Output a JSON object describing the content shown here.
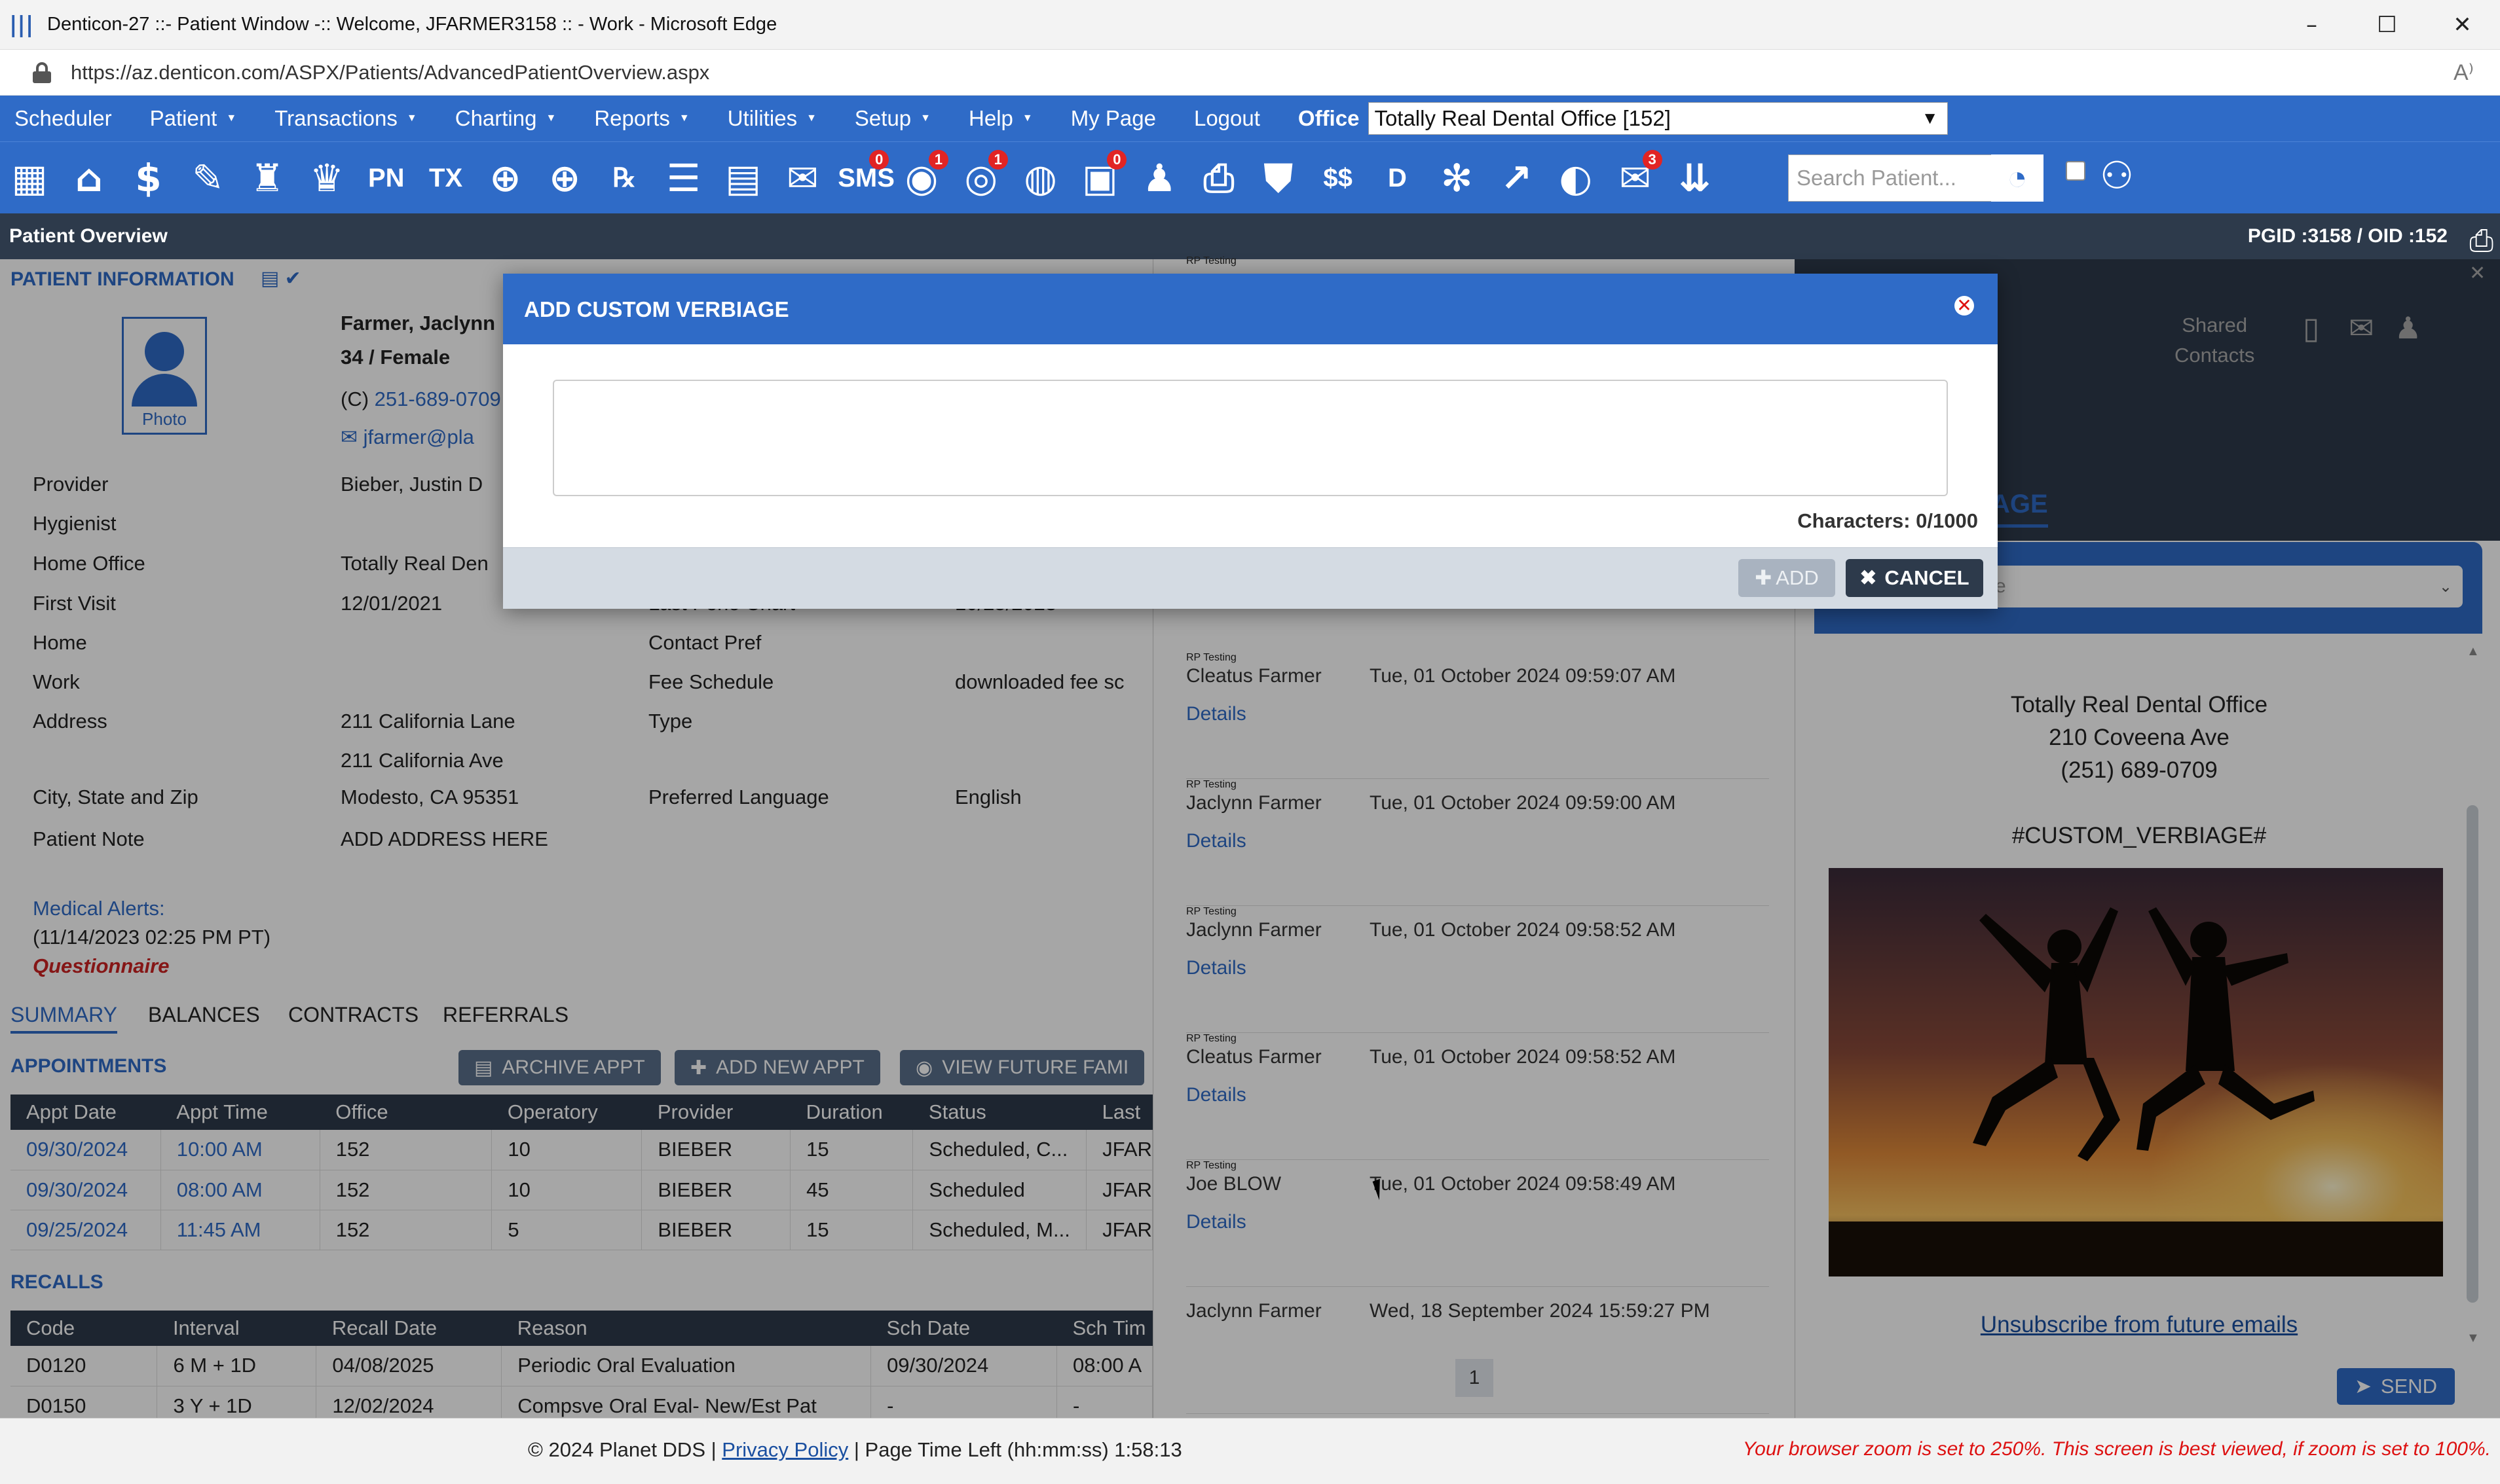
{
  "window": {
    "title": "Denticon-27 ::- Patient Window -:: Welcome, JFARMER3158 :: - Work - Microsoft Edge",
    "url": "https://az.denticon.com/ASPX/Patients/AdvancedPatientOverview.aspx"
  },
  "nav": {
    "items": [
      {
        "label": "Scheduler",
        "caret": false
      },
      {
        "label": "Patient",
        "caret": true
      },
      {
        "label": "Transactions",
        "caret": true
      },
      {
        "label": "Charting",
        "caret": true
      },
      {
        "label": "Reports",
        "caret": true
      },
      {
        "label": "Utilities",
        "caret": true
      },
      {
        "label": "Setup",
        "caret": true
      },
      {
        "label": "Help",
        "caret": true
      },
      {
        "label": "My Page",
        "caret": false
      },
      {
        "label": "Logout",
        "caret": false
      }
    ],
    "office_label": "Office",
    "office_value": "Totally Real Dental Office [152]"
  },
  "toolbar": {
    "icons": [
      {
        "name": "calendar-icon",
        "glyph": "▦"
      },
      {
        "name": "home-icon",
        "glyph": "⌂"
      },
      {
        "name": "dollar-icon",
        "glyph": "$"
      },
      {
        "name": "edit-icon",
        "glyph": "✎"
      },
      {
        "name": "tooth-chart-icon",
        "glyph": "♜"
      },
      {
        "name": "tooth-icon",
        "glyph": "♛"
      },
      {
        "name": "pn-icon",
        "text": "PN"
      },
      {
        "name": "tx-icon",
        "text": "TX"
      },
      {
        "name": "add-user-icon",
        "glyph": "⊕"
      },
      {
        "name": "add-user-alt-icon",
        "glyph": "⊕"
      },
      {
        "name": "prescription-icon",
        "text": "℞"
      },
      {
        "name": "notes-icon",
        "glyph": "☰"
      },
      {
        "name": "document-icon",
        "glyph": "▤"
      },
      {
        "name": "mail-icon",
        "glyph": "✉"
      },
      {
        "name": "sms-icon",
        "text": "SMS",
        "badge": "0"
      },
      {
        "name": "web-users-icon",
        "glyph": "◉",
        "badge": "1"
      },
      {
        "name": "support-icon",
        "glyph": "◎",
        "badge": "1"
      },
      {
        "name": "globe-icon",
        "glyph": "◍"
      },
      {
        "name": "clipboard-icon",
        "glyph": "▣",
        "badge": "0"
      },
      {
        "name": "family-icon",
        "glyph": "♟"
      },
      {
        "name": "printer-icon",
        "glyph": "⎙"
      },
      {
        "name": "insurance-icon",
        "glyph": "⛊"
      },
      {
        "name": "claims-icon",
        "text": "$$"
      },
      {
        "name": "ledger-icon",
        "text": "D"
      },
      {
        "name": "network-icon",
        "glyph": "✻"
      },
      {
        "name": "analytics-icon",
        "glyph": "↗"
      },
      {
        "name": "profile-icon",
        "glyph": "◐"
      },
      {
        "name": "messages-icon",
        "glyph": "✉",
        "badge": "3"
      },
      {
        "name": "collapse-icon",
        "glyph": "⇊"
      }
    ],
    "search_placeholder": "Search Patient..."
  },
  "pagebar": {
    "title": "Patient Overview",
    "pgid": "PGID :3158  /  OID :152"
  },
  "patient": {
    "section": "PATIENT INFORMATION",
    "photo_label": "Photo",
    "name": "Farmer, Jaclynn",
    "age_sex": "34 / Female",
    "phone_prefix": "(C)",
    "phone": "251-689-0709",
    "email": "jfarmer@pla",
    "fields": [
      {
        "label": "Provider",
        "value": "Bieber, Justin D"
      },
      {
        "label": "Hygienist",
        "value": ""
      },
      {
        "label": "Home Office",
        "value": "Totally Real Den"
      },
      {
        "label": "First Visit",
        "value": "12/01/2021"
      },
      {
        "label": "Home",
        "value": ""
      },
      {
        "label": "Work",
        "value": ""
      },
      {
        "label": "Address",
        "value": "211 California Lane"
      },
      {
        "label": "",
        "value": "211 California Ave"
      },
      {
        "label": "City, State and Zip",
        "value": "Modesto, CA 95351"
      },
      {
        "label": "Patient Note",
        "value": "ADD ADDRESS HERE"
      }
    ],
    "mid_fields": [
      {
        "label": "Last Perio Chart",
        "value": "10/25/2023"
      },
      {
        "label": "Contact Pref",
        "value": ""
      },
      {
        "label": "Fee Schedule",
        "value": "downloaded fee sc"
      },
      {
        "label": "Type",
        "value": ""
      },
      {
        "label": "Preferred Language",
        "value": "English"
      }
    ],
    "medical_alerts": "Medical Alerts:",
    "alerts_date": "(11/14/2023 02:25 PM PT)",
    "questionnaire": "Questionnaire"
  },
  "tabs": [
    "SUMMARY",
    "BALANCES",
    "CONTRACTS",
    "REFERRALS"
  ],
  "appointments": {
    "title": "APPOINTMENTS",
    "buttons": [
      "ARCHIVE APPT",
      "ADD NEW APPT",
      "VIEW FUTURE FAMI"
    ],
    "headers": [
      "Appt Date",
      "Appt Time",
      "Office",
      "Operatory",
      "Provider",
      "Duration",
      "Status",
      "Last"
    ],
    "rows": [
      [
        "09/30/2024",
        "10:00 AM",
        "152",
        "10",
        "BIEBER",
        "15",
        "Scheduled, C...",
        "JFAR"
      ],
      [
        "09/30/2024",
        "08:00 AM",
        "152",
        "10",
        "BIEBER",
        "45",
        "Scheduled",
        "JFAR"
      ],
      [
        "09/25/2024",
        "11:45 AM",
        "152",
        "5",
        "BIEBER",
        "15",
        "Scheduled, M...",
        "JFAR"
      ]
    ]
  },
  "recalls": {
    "title": "RECALLS",
    "headers": [
      "Code",
      "Interval",
      "Recall Date",
      "Reason",
      "Sch Date",
      "Sch Tim"
    ],
    "rows": [
      [
        "D0120",
        "6 M + 1D",
        "04/08/2025",
        "Periodic Oral Evaluation",
        "09/30/2024",
        "08:00 A"
      ],
      [
        "D0150",
        "3 Y + 1D",
        "12/02/2024",
        "Compsve Oral Eval- New/Est Pat",
        "-",
        "-"
      ]
    ]
  },
  "messages": [
    {
      "from": "",
      "when": "",
      "details": "Details",
      "subject": "RP Testing"
    },
    {
      "from": "Cleatus Farmer",
      "when": "Tue, 01 October 2024 09:59:07 AM",
      "details": "Details",
      "subject": "RP Testing"
    },
    {
      "from": "Jaclynn Farmer",
      "when": "Tue, 01 October 2024 09:59:00 AM",
      "details": "Details",
      "subject": "RP Testing"
    },
    {
      "from": "Jaclynn Farmer",
      "when": "Tue, 01 October 2024 09:58:52 AM",
      "details": "Details",
      "subject": "RP Testing"
    },
    {
      "from": "Cleatus Farmer",
      "when": "Tue, 01 October 2024 09:58:52 AM",
      "details": "Details",
      "subject": "RP Testing"
    },
    {
      "from": "Joe BLOW",
      "when": "Tue, 01 October 2024 09:58:49 AM",
      "details": "Details",
      "subject": "RP Testing"
    },
    {
      "from": "Jaclynn Farmer",
      "when": "Wed, 18 September 2024 15:59:27 PM",
      "details": "",
      "subject": ""
    }
  ],
  "pager": "1",
  "email_panel": {
    "shared": "Shared",
    "contacts": "Contacts",
    "tab_word": "AGE",
    "select_value": "e",
    "office_name": "Totally Real Dental Office",
    "address": "210 Coveena Ave",
    "phone": "(251) 689-0709",
    "custom_tag": "#CUSTOM_VERBIAGE#",
    "unsubscribe": "Unsubscribe from future emails",
    "send": "SEND"
  },
  "modal": {
    "title": "ADD CUSTOM VERBIAGE",
    "value": "",
    "char_count": "Characters: 0/1000",
    "add": "ADD",
    "cancel": "CANCEL"
  },
  "footer": {
    "copyright": "© 2024 Planet DDS |",
    "privacy": "Privacy Policy",
    "page_time": "| Page Time Left (hh:mm:ss) 1:58:13",
    "zoom_warning": "Your browser zoom is set to 250%. This screen is best viewed, if zoom is set to 100%."
  }
}
